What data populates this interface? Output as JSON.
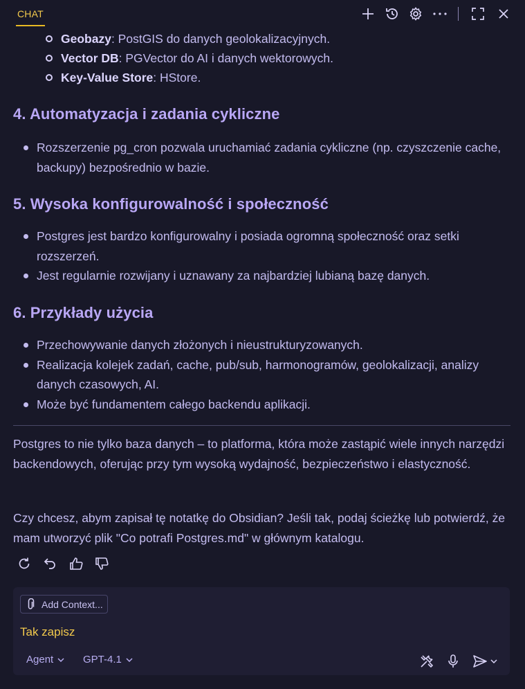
{
  "header": {
    "tab_label": "CHAT",
    "icons": [
      "plus-icon",
      "history-icon",
      "gear-icon",
      "more-icon",
      "maximize-icon",
      "close-icon"
    ]
  },
  "sub_items": [
    {
      "bold": "Geobazy",
      "text": ": PostGIS do danych geolokalizacyjnych."
    },
    {
      "bold": "Vector DB",
      "text": ": PGVector do AI i danych wektorowych."
    },
    {
      "bold": "Key-Value Store",
      "text": ": HStore."
    }
  ],
  "sections": [
    {
      "heading": "4. Automatyzacja i zadania cykliczne",
      "bullets": [
        "Rozszerzenie pg_cron pozwala uruchamiać zadania cykliczne (np. czyszczenie cache, backupy) bezpośrednio w bazie."
      ]
    },
    {
      "heading": "5. Wysoka konfigurowalność i społeczność",
      "bullets": [
        "Postgres jest bardzo konfigurowalny i posiada ogromną społeczność oraz setki rozszerzeń.",
        "Jest regularnie rozwijany i uznawany za najbardziej lubianą bazę danych."
      ]
    },
    {
      "heading": "6. Przykłady użycia",
      "bullets": [
        "Przechowywanie danych złożonych i nieustrukturyzowanych.",
        "Realizacja kolejek zadań, cache, pub/sub, harmonogramów, geolokalizacji, analizy danych czasowych, AI.",
        "Może być fundamentem całego backendu aplikacji."
      ]
    }
  ],
  "summary": "Postgres to nie tylko baza danych – to platforma, która może zastąpić wiele innych narzędzi backendowych, oferując przy tym wysoką wydajność, bezpieczeństwo i elastyczność.",
  "question": "Czy chcesz, abym zapisał tę notatkę do Obsidian? Jeśli tak, podaj ścieżkę lub potwierdź, że mam utworzyć plik \"Co potrafi Postgres.md\" w głównym katalogu.",
  "message_actions": [
    "retry-icon",
    "undo-icon",
    "thumbs-up-icon",
    "thumbs-down-icon"
  ],
  "composer": {
    "add_context_label": "Add Context...",
    "input_value": "Tak zapisz",
    "mode_label": "Agent",
    "model_label": "GPT-4.1",
    "icons": [
      "tools-icon",
      "microphone-icon",
      "send-icon"
    ]
  },
  "colors": {
    "background": "#181828",
    "accent": "#f2c94c",
    "heading": "#b9a7f5",
    "text": "#c3bbef",
    "composer_bg": "#1f1e33"
  }
}
